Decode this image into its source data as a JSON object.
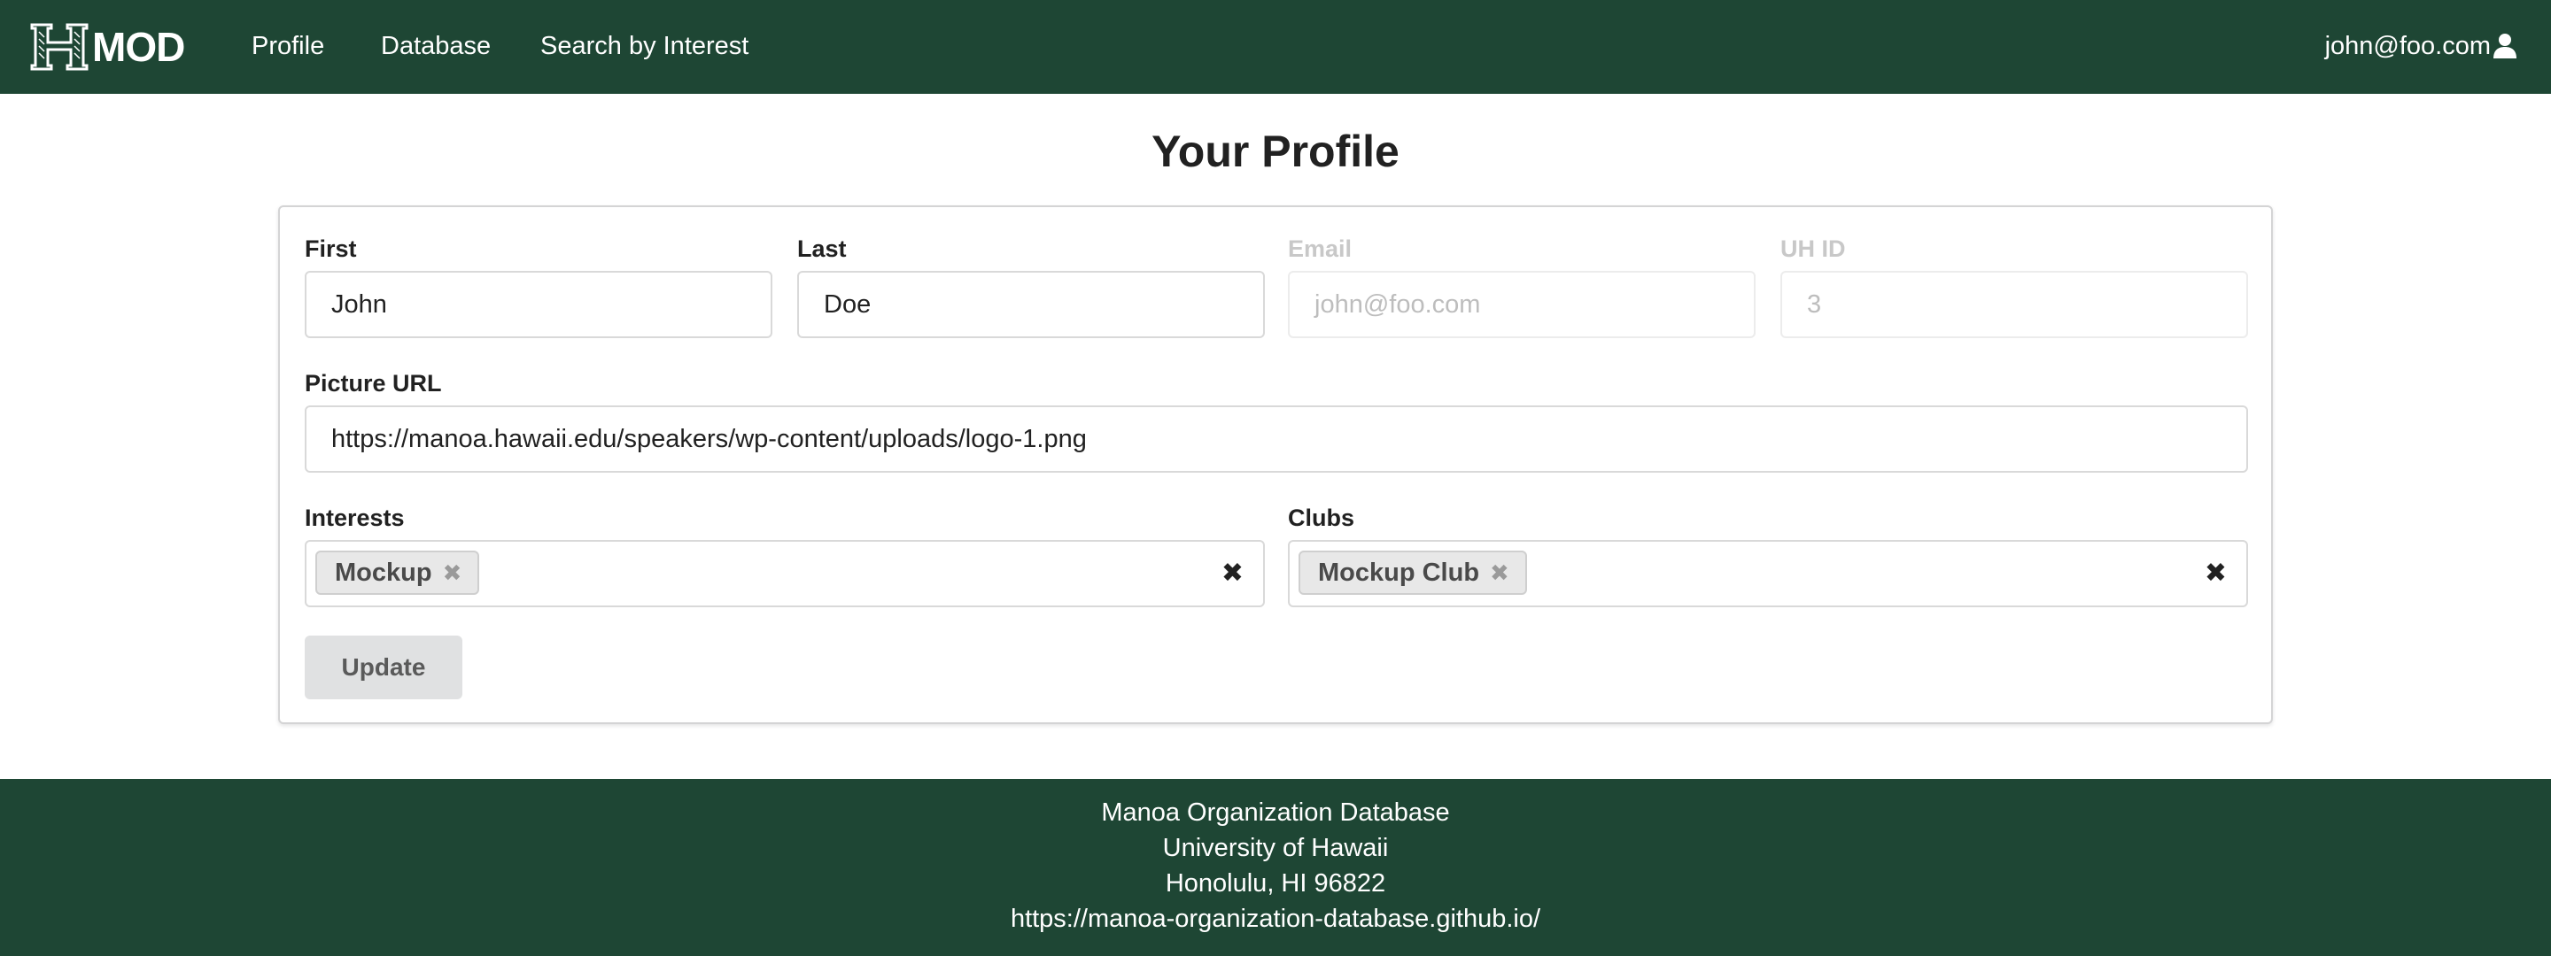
{
  "navbar": {
    "brand_text": "MOD",
    "links": {
      "profile": "Profile",
      "database": "Database",
      "search": "Search by Interest"
    },
    "user_email": "john@foo.com",
    "user_icon": "user-icon",
    "background": "#1e4634"
  },
  "page": {
    "title": "Your Profile"
  },
  "form": {
    "first": {
      "label": "First",
      "value": "John"
    },
    "last": {
      "label": "Last",
      "value": "Doe"
    },
    "email": {
      "label": "Email",
      "value": "john@foo.com",
      "disabled": true
    },
    "uhid": {
      "label": "UH ID",
      "value": "3",
      "disabled": true
    },
    "picture": {
      "label": "Picture URL",
      "value": "https://manoa.hawaii.edu/speakers/wp-content/uploads/logo-1.png"
    },
    "interests": {
      "label": "Interests",
      "selected": [
        "Mockup"
      ]
    },
    "clubs": {
      "label": "Clubs",
      "selected": [
        "Mockup Club"
      ]
    },
    "update_label": "Update"
  },
  "footer": {
    "line1": "Manoa Organization Database",
    "line2": "University of Hawaii",
    "line3": "Honolulu, HI 96822",
    "line4": "https://manoa-organization-database.github.io/"
  }
}
